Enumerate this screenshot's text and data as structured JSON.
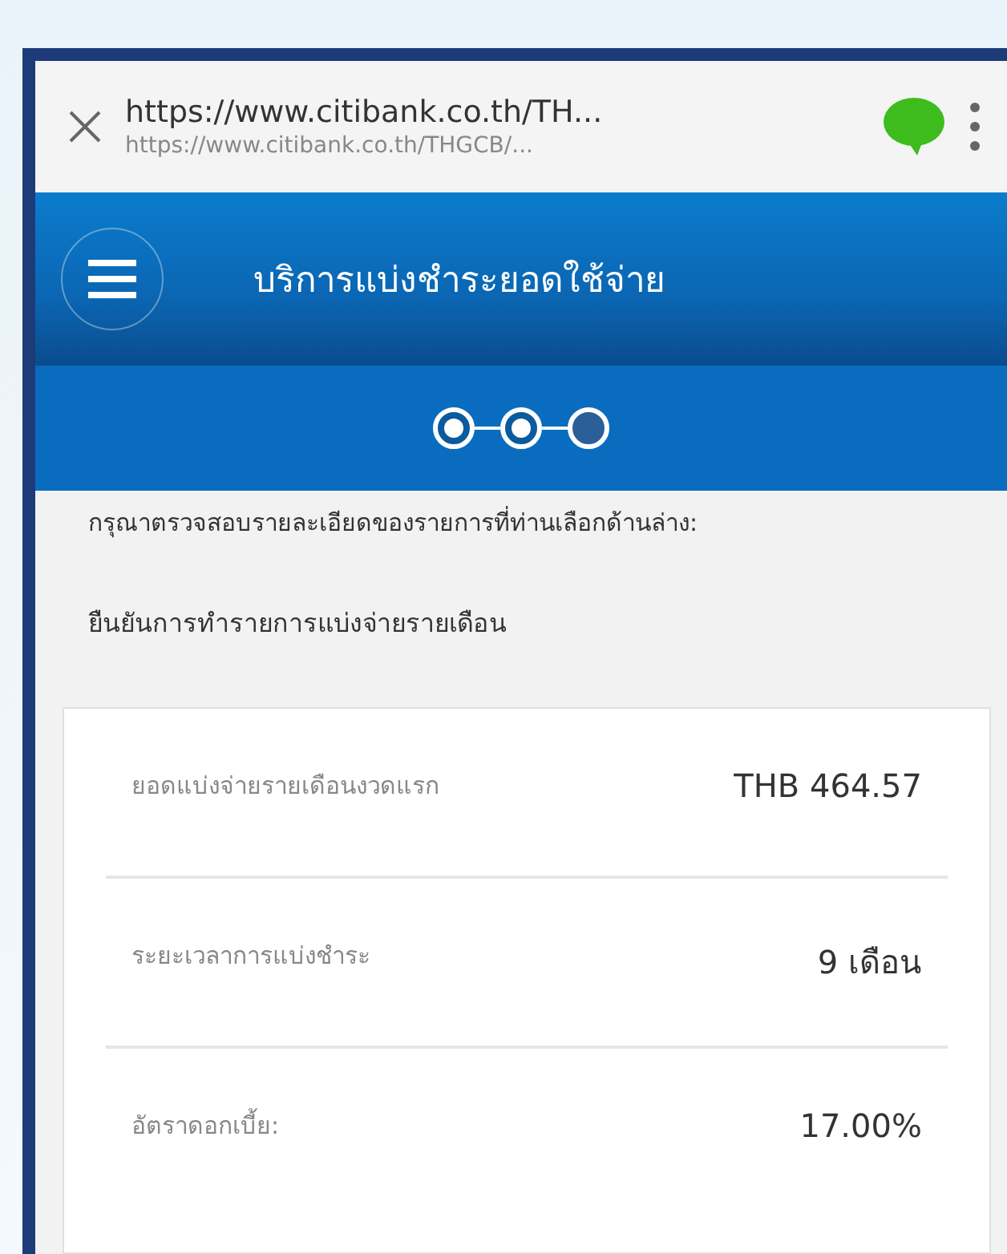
{
  "browser_bar": {
    "title": "https://www.citibank.co.th/TH...",
    "url": "https://www.citibank.co.th/THGCB/..."
  },
  "header": {
    "title": "บริการแบ่งชำระยอดใช้จ่าย"
  },
  "steps": [
    {
      "completed": true
    },
    {
      "completed": true
    },
    {
      "completed": false
    }
  ],
  "instruction": "กรุณาตรวจสอบรายละเอียดของรายการที่ท่านเลือกด้านล่าง:",
  "section_title": "ยืนยันการทำรายการแบ่งจ่ายรายเดือน",
  "details": [
    {
      "label": "ยอดแบ่งจ่ายรายเดือนงวดแรก",
      "value": "THB 464.57"
    },
    {
      "label": "ระยะเวลาการแบ่งชำระ",
      "value": "9 เดือน"
    },
    {
      "label": "อัตราดอกเบี้ย:",
      "value": "17.00%"
    }
  ]
}
